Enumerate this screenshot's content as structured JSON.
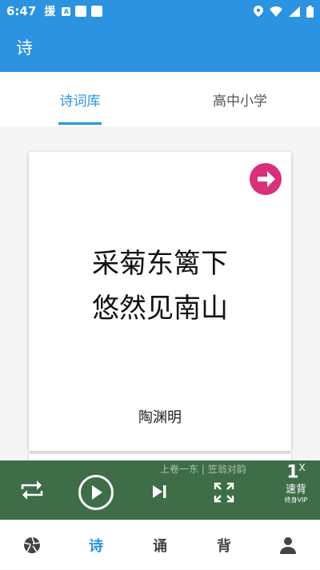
{
  "status_bar": {
    "time": "6:47",
    "app_char": "援",
    "notif_letter": "A"
  },
  "app_bar": {
    "title": "诗"
  },
  "tabs": [
    {
      "label": "诗词库",
      "active": true
    },
    {
      "label": "高中小学",
      "active": false
    }
  ],
  "card": {
    "lines": [
      "采菊东篱下",
      "悠然见南山"
    ],
    "author": "陶渊明",
    "next_icon": "arrow-right-circle-icon"
  },
  "player": {
    "subtitle": "上卷一东 | 笠翁对韵",
    "speed_value": "1",
    "speed_suffix": "X",
    "speed_label": "速背",
    "vip_label": "终身VIP",
    "icons": [
      "repeat-icon",
      "play-icon",
      "skip-next-icon",
      "fullscreen-icon"
    ]
  },
  "bottom_nav": [
    {
      "icon": "aperture-icon",
      "label": ""
    },
    {
      "label": "诗",
      "active": true
    },
    {
      "label": "诵"
    },
    {
      "label": "背"
    },
    {
      "icon": "person-icon",
      "label": ""
    }
  ],
  "colors": {
    "primary": "#2b93e0",
    "player_bg": "#3e6d48",
    "next_button": "#d9307a"
  }
}
